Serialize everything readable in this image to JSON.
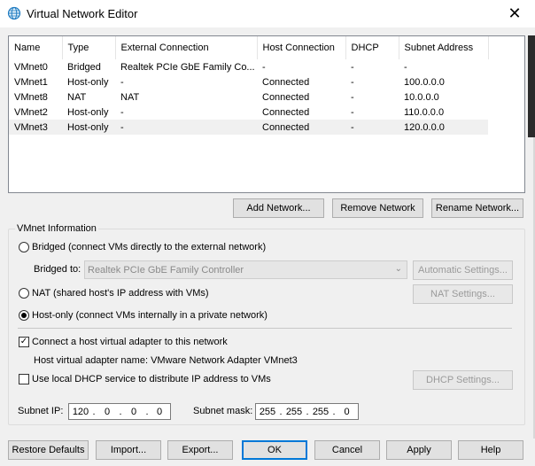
{
  "window": {
    "title": "Virtual Network Editor",
    "close_glyph": "✕",
    "icon": "network-globe-icon"
  },
  "table": {
    "columns": [
      "Name",
      "Type",
      "External Connection",
      "Host Connection",
      "DHCP",
      "Subnet Address"
    ],
    "rows": [
      {
        "name": "VMnet0",
        "type": "Bridged",
        "external": "Realtek PCIe GbE Family Co...",
        "host": "-",
        "dhcp": "-",
        "subnet": "-"
      },
      {
        "name": "VMnet1",
        "type": "Host-only",
        "external": "-",
        "host": "Connected",
        "dhcp": "-",
        "subnet": "100.0.0.0"
      },
      {
        "name": "VMnet8",
        "type": "NAT",
        "external": "NAT",
        "host": "Connected",
        "dhcp": "-",
        "subnet": "10.0.0.0"
      },
      {
        "name": "VMnet2",
        "type": "Host-only",
        "external": "-",
        "host": "Connected",
        "dhcp": "-",
        "subnet": "110.0.0.0"
      },
      {
        "name": "VMnet3",
        "type": "Host-only",
        "external": "-",
        "host": "Connected",
        "dhcp": "-",
        "subnet": "120.0.0.0",
        "selected": true
      }
    ]
  },
  "network_buttons": {
    "add": "Add Network...",
    "remove": "Remove Network",
    "rename": "Rename Network..."
  },
  "vmnet_info": {
    "group_label": "VMnet Information",
    "bridged_label": "Bridged (connect VMs directly to the external network)",
    "bridged_to_label": "Bridged to:",
    "bridged_to_value": "Realtek PCIe GbE Family Controller",
    "automatic_settings": "Automatic Settings...",
    "nat_label": "NAT (shared host's IP address with VMs)",
    "nat_settings": "NAT Settings...",
    "hostonly_label": "Host-only (connect VMs internally in a private network)",
    "selected_mode": "host-only",
    "connect_adapter_label": "Connect a host virtual adapter to this network",
    "connect_adapter_checked": true,
    "adapter_name_label": "Host virtual adapter name: VMware Network Adapter VMnet3",
    "dhcp_label": "Use local DHCP service to distribute IP address to VMs",
    "dhcp_checked": false,
    "dhcp_settings": "DHCP Settings...",
    "subnet_ip_label": "Subnet IP:",
    "subnet_ip": [
      "120",
      "0",
      "0",
      "0"
    ],
    "subnet_mask_label": "Subnet mask:",
    "subnet_mask": [
      "255",
      "255",
      "255",
      "0"
    ]
  },
  "footer": {
    "restore": "Restore Defaults",
    "import": "Import...",
    "export": "Export...",
    "ok": "OK",
    "cancel": "Cancel",
    "apply": "Apply",
    "help": "Help"
  }
}
